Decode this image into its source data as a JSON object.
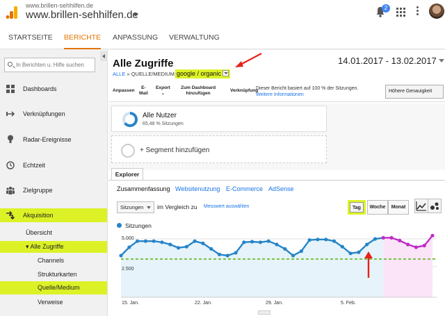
{
  "app": {
    "account_small": "www.brillen-sehhilfen.de",
    "account_main": "www.brillen-sehhilfen.de",
    "notification_count": "2"
  },
  "nav": {
    "tabs": [
      {
        "label": "STARTSEITE"
      },
      {
        "label": "BERICHTE"
      },
      {
        "label": "ANPASSUNG"
      },
      {
        "label": "VERWALTUNG"
      }
    ],
    "active": "BERICHTE"
  },
  "sidebar": {
    "search_placeholder": "In Berichten u. Hilfe suchen",
    "items": [
      {
        "label": "Dashboards",
        "icon": "grid-icon"
      },
      {
        "label": "Verknüpfungen",
        "icon": "shortcut-icon"
      },
      {
        "label": "Radar-Ereignisse",
        "icon": "lightbulb-icon"
      },
      {
        "label": "Echtzeit",
        "icon": "clock-icon"
      },
      {
        "label": "Zielgruppe",
        "icon": "people-icon"
      },
      {
        "label": "Akquisition",
        "icon": "acquisition-icon"
      }
    ],
    "sub": {
      "overview": "Übersicht",
      "all_traffic": "▾ Alle Zugriffe",
      "channels": "Channels",
      "treemaps": "Strukturkarten",
      "source_medium": "Quelle/Medium",
      "referrals": "Verweise"
    },
    "highlight_color": "#dcf226"
  },
  "report": {
    "title": "Alle Zugriffe",
    "crumb_all": "ALLE",
    "crumb_sep": "»",
    "crumb_dim": "QUELLE/MEDIUM:",
    "crumb_value": "google / organic",
    "date_range": "14.01.2017 - 13.02.2017"
  },
  "toolbar": {
    "save": "Anpassen",
    "email_1": "E-",
    "email_2": "Mail",
    "export": "Export",
    "dashboard_1": "Zum Dashboard",
    "dashboard_2": "hinzufügen",
    "shortcut": "Verknüpfung",
    "info_1": "Dieser Bericht basiert auf 100 % der Sitzungen.",
    "info_link": "Weitere Informationen",
    "precision": "Höhere Genauigkeit"
  },
  "segments": {
    "name": "Alle Nutzer",
    "sub": "65,48 % Sitzungen",
    "add": "+ Segment hinzufügen"
  },
  "explorer": {
    "tab": "Explorer",
    "subtabs": [
      "Zusammenfassung",
      "Websitenutzung",
      "E-Commerce",
      "AdSense"
    ]
  },
  "chart_controls": {
    "metric": "Sitzungen",
    "compare": "im Vergleich zu",
    "metric_link": "Messwert auswählen",
    "day": "Tag",
    "week": "Woche",
    "month": "Monat"
  },
  "chart_data": {
    "type": "line",
    "series": [
      {
        "name": "Sitzungen",
        "values": [
          3500,
          4250,
          4800,
          4800,
          4800,
          4700,
          4500,
          4200,
          4300,
          4800,
          4600,
          4100,
          3600,
          3500,
          3750,
          4700,
          4750,
          4700,
          4800,
          4500,
          4100,
          3500,
          3900,
          4900,
          4950,
          4950,
          4800,
          4300,
          3700,
          3800,
          4500,
          5000,
          5100,
          5100,
          4850,
          4500,
          4250,
          4400,
          5300
        ]
      }
    ],
    "y_ticks": [
      "5.000",
      "2.500"
    ],
    "x_ticks": [
      "15. Jan.",
      "22. Jan.",
      "29. Jan.",
      "5. Feb."
    ],
    "line_color": "#2684c8",
    "highlight_color": "#c02bc8",
    "average_line_color": "#7ac143",
    "highlight_start_index": 32
  }
}
